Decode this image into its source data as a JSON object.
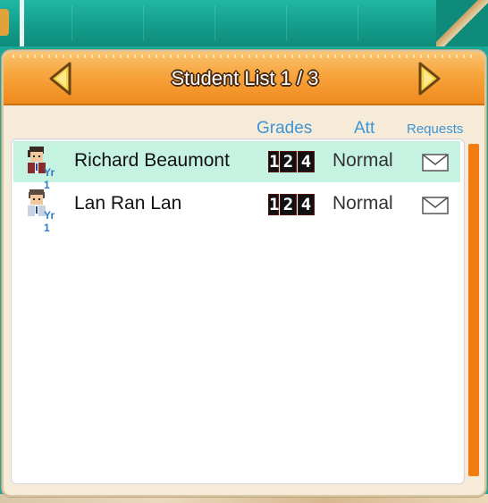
{
  "header": {
    "title": "Student List 1 / 3"
  },
  "columns": {
    "grades": "Grades",
    "att": "Att",
    "requests": "Requests"
  },
  "students": [
    {
      "name": "Richard Beaumont",
      "year": "Yr 1",
      "grade": [
        "1",
        "2",
        "4"
      ],
      "attendance": "Normal",
      "selected": true
    },
    {
      "name": "Lan Ran Lan",
      "year": "Yr 1",
      "grade": [
        "1",
        "2",
        "4"
      ],
      "attendance": "Normal",
      "selected": false
    }
  ],
  "icons": {
    "prev": "arrow-left-icon",
    "next": "arrow-right-icon",
    "request": "envelope-icon",
    "avatar": "student-portrait-icon"
  },
  "colors": {
    "header": "#f7a43c",
    "selected_row": "#c6f2e2",
    "column_heading": "#3d95d6",
    "scrollbar": "#ef7d0f"
  }
}
